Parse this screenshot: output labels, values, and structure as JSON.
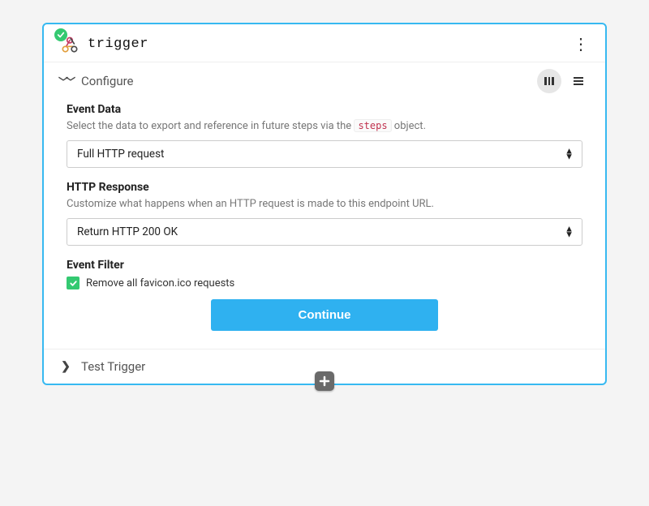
{
  "header": {
    "title": "trigger"
  },
  "configure": {
    "title": "Configure",
    "event_data": {
      "title": "Event Data",
      "desc_pre": "Select the data to export and reference in future steps via the ",
      "desc_code": "steps",
      "desc_post": " object.",
      "value": "Full HTTP request"
    },
    "http_response": {
      "title": "HTTP Response",
      "desc": "Customize what happens when an HTTP request is made to this endpoint URL.",
      "value": "Return HTTP 200 OK"
    },
    "event_filter": {
      "title": "Event Filter",
      "checkbox_label": "Remove all favicon.ico requests",
      "checked": true
    },
    "continue_label": "Continue"
  },
  "test": {
    "title": "Test Trigger"
  }
}
